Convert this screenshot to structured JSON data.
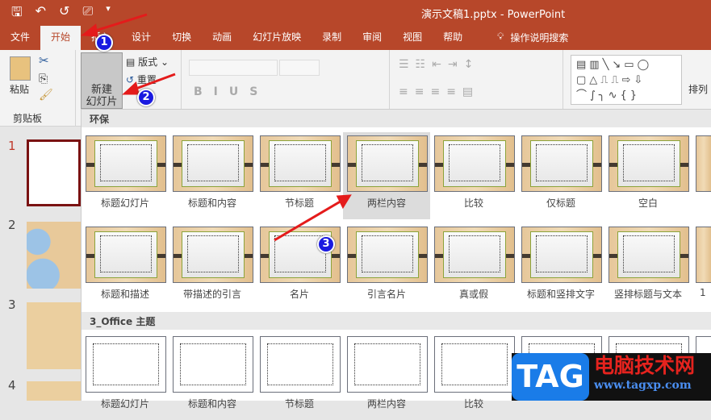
{
  "window": {
    "title": "演示文稿1.pptx  -  PowerPoint"
  },
  "qat": {
    "save": "🖫",
    "undo": "↶",
    "redo": "↺",
    "present": "⎚",
    "more": "▾"
  },
  "tabs": [
    "文件",
    "开始",
    "插入",
    "设计",
    "切换",
    "动画",
    "幻灯片放映",
    "录制",
    "审阅",
    "视图",
    "帮助"
  ],
  "tell_me": "操作说明搜索",
  "ribbon": {
    "paste": "粘贴",
    "clipboard": "剪贴板",
    "new_slide_line1": "新建",
    "new_slide_line2": "幻灯片 ⌄",
    "layout": "版式 ⌄",
    "reset": "重置",
    "arrange": "排列"
  },
  "thumbs": [
    "1",
    "2",
    "3",
    "4"
  ],
  "gallery": {
    "sections": [
      {
        "title": "环保",
        "style": "wood",
        "items": [
          "标题幻灯片",
          "标题和内容",
          "节标题",
          "两栏内容",
          "比较",
          "仅标题",
          "空白",
          "",
          "标题和描述",
          "带描述的引言",
          "名片",
          "引言名片",
          "真或假",
          "标题和竖排文字",
          "竖排标题与文本",
          "1"
        ]
      },
      {
        "title": "3_Office 主题",
        "style": "white",
        "items": [
          "标题幻灯片",
          "标题和内容",
          "节标题",
          "两栏内容",
          "比较",
          "",
          "",
          ""
        ]
      }
    ],
    "selected": "两栏内容"
  },
  "annotations": [
    "1",
    "2",
    "3"
  ],
  "watermark": {
    "logo": "TAG",
    "name": "电脑技术网",
    "url": "www.tagxp.com"
  }
}
